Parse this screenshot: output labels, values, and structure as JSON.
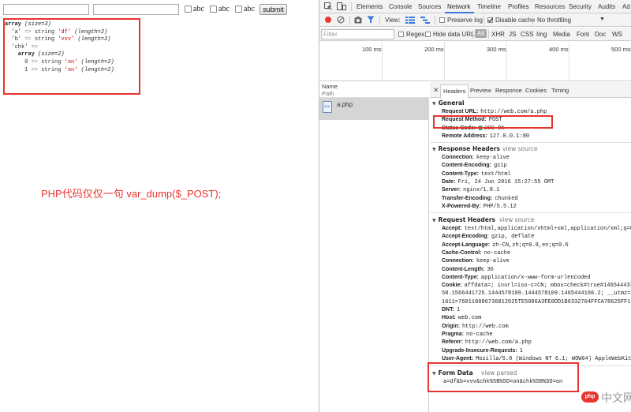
{
  "form": {
    "input1_value": "",
    "input2_value": "",
    "checkbox_labels": [
      "abc",
      "abc",
      "abc"
    ],
    "submit_label": "submit"
  },
  "dump": {
    "lines": [
      [
        {
          "t": "array",
          "c": "b"
        },
        {
          "t": " (size=3)",
          "c": "i"
        }
      ],
      [
        {
          "t": "  'a' ",
          "c": "n"
        },
        {
          "t": "=>",
          "c": "g"
        },
        {
          "t": " string ",
          "c": "n"
        },
        {
          "t": "'df'",
          "c": "s"
        },
        {
          "t": " (length=2)",
          "c": "i"
        }
      ],
      [
        {
          "t": "  'b' ",
          "c": "n"
        },
        {
          "t": "=>",
          "c": "g"
        },
        {
          "t": " string ",
          "c": "n"
        },
        {
          "t": "'vvv'",
          "c": "s"
        },
        {
          "t": " (length=3)",
          "c": "i"
        }
      ],
      [
        {
          "t": "  'chk' ",
          "c": "n"
        },
        {
          "t": "=>",
          "c": "g"
        }
      ],
      [
        {
          "t": "    array",
          "c": "b"
        },
        {
          "t": " (size=2)",
          "c": "i"
        }
      ],
      [
        {
          "t": "      0 ",
          "c": "n"
        },
        {
          "t": "=>",
          "c": "g"
        },
        {
          "t": " string ",
          "c": "n"
        },
        {
          "t": "'on'",
          "c": "s"
        },
        {
          "t": " (length=2)",
          "c": "i"
        }
      ],
      [
        {
          "t": "      1 ",
          "c": "n"
        },
        {
          "t": "=>",
          "c": "g"
        },
        {
          "t": " string ",
          "c": "n"
        },
        {
          "t": "'on'",
          "c": "s"
        },
        {
          "t": " (length=2)",
          "c": "i"
        }
      ]
    ]
  },
  "annotation": "PHP代码仅仅一句 var_dump($_POST);",
  "devtools": {
    "tabs": [
      "Elements",
      "Console",
      "Sources",
      "Network",
      "Timeline",
      "Profiles",
      "Resources",
      "Security",
      "Audits",
      "Ad"
    ],
    "active_tab": "Network",
    "toolbar": {
      "view_label": "View:",
      "preserve_log": "Preserve log",
      "disable_cache": "Disable cache",
      "throttling": "No throttling"
    },
    "filter": {
      "placeholder": "Filter",
      "regex": "Regex",
      "hide_data_urls": "Hide data URLs",
      "types": [
        "All",
        "XHR",
        "JS",
        "CSS",
        "Img",
        "Media",
        "Font",
        "Doc",
        "WS"
      ]
    },
    "timeline_ticks": [
      "100 ms",
      "200 ms",
      "300 ms",
      "400 ms",
      "500 ms"
    ],
    "request_list": {
      "name_header": "Name",
      "path_header": "Path",
      "requests": [
        "a.php"
      ]
    },
    "detail_tabs": [
      "Headers",
      "Preview",
      "Response",
      "Cookies",
      "Timing"
    ],
    "active_detail_tab": "Headers",
    "general": {
      "title": "General",
      "rows": [
        {
          "k": "Request URL:",
          "v": "http://web.com/a.php"
        },
        {
          "k": "Request Method:",
          "v": "POST"
        },
        {
          "k": "Status Code:",
          "v": "200 OK"
        },
        {
          "k": "Remote Address:",
          "v": "127.0.0.1:80"
        }
      ]
    },
    "response_headers": {
      "title": "Response Headers",
      "view_source": "view source",
      "rows": [
        {
          "k": "Connection:",
          "v": "keep-alive"
        },
        {
          "k": "Content-Encoding:",
          "v": "gzip"
        },
        {
          "k": "Content-Type:",
          "v": "text/html"
        },
        {
          "k": "Date:",
          "v": "Fri, 24 Jun 2016 15:27:55 GMT"
        },
        {
          "k": "Server:",
          "v": "nginx/1.8.1"
        },
        {
          "k": "Transfer-Encoding:",
          "v": "chunked"
        },
        {
          "k": "X-Powered-By:",
          "v": "PHP/5.5.12"
        }
      ]
    },
    "request_headers": {
      "title": "Request Headers",
      "view_source": "view source",
      "rows": [
        {
          "k": "Accept:",
          "v": "text/html,application/xhtml+xml,application/xml;q=0"
        },
        {
          "k": "Accept-Encoding:",
          "v": "gzip, deflate"
        },
        {
          "k": "Accept-Language:",
          "v": "zh-CN,zh;q=0.8,en;q=0.6"
        },
        {
          "k": "Cache-Control:",
          "v": "no-cache"
        },
        {
          "k": "Connection:",
          "v": "keep-alive"
        },
        {
          "k": "Content-Length:",
          "v": "36"
        },
        {
          "k": "Content-Type:",
          "v": "application/x-www-form-urlencoded"
        },
        {
          "k": "Cookie:",
          "v": "affdata=; inurl=iso-c=CN; mbox=check#true#146544433"
        },
        {
          "k": "",
          "v": "58.1566441725.1444578109.1444578109.1465444166.2; __utmz=1"
        },
        {
          "k": "",
          "v": "1611=760118086736812025TE5006A3FE0DD1B6332704FFCA78625FF14"
        },
        {
          "k": "DNT:",
          "v": "1"
        },
        {
          "k": "Host:",
          "v": "web.com"
        },
        {
          "k": "Origin:",
          "v": "http://web.com"
        },
        {
          "k": "Pragma:",
          "v": "no-cache"
        },
        {
          "k": "Referer:",
          "v": "http://web.com/a.php"
        },
        {
          "k": "Upgrade-Insecure-Requests:",
          "v": "1"
        },
        {
          "k": "User-Agent:",
          "v": "Mozilla/5.0 (Windows NT 6.1; WOW64) AppleWebKit"
        }
      ]
    },
    "form_data": {
      "title": "Form Data",
      "view_parsed": "view parsed",
      "value": "a=df&b=vvv&chk%5B%5D=on&chk%5B%5D=on"
    }
  },
  "watermark": {
    "icon_text": "php",
    "text": "中文网"
  },
  "colors": {
    "annotation_red": "#e8342e",
    "record_red": "#e53935",
    "active_blue": "#3879d9",
    "status_green": "#2aa84a"
  }
}
